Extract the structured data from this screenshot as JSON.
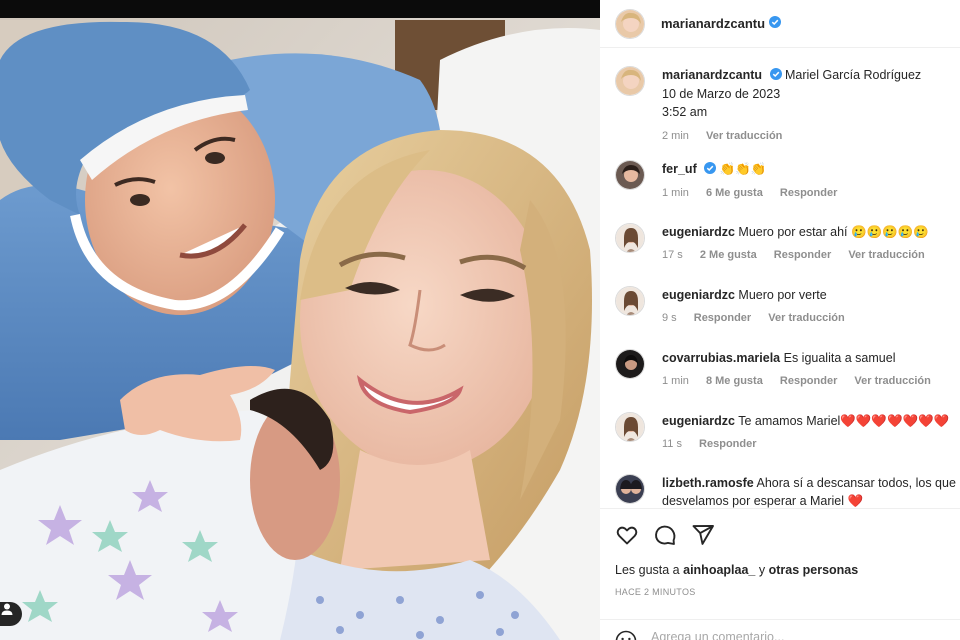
{
  "post": {
    "author": "marianardzcantu",
    "tag_icon": "user-tag-icon"
  },
  "caption": {
    "username": "marianardzcantu",
    "text": "Mariel García Rodríguez",
    "line2": "10 de Marzo de 2023",
    "line3": "3:52 am",
    "time": "2 min",
    "translate": "Ver traducción"
  },
  "comments": [
    {
      "username": "fer_uf",
      "verified": true,
      "text": "👏👏👏",
      "time": "1 min",
      "likes": "6 Me gusta",
      "reply": "Responder",
      "translate": ""
    },
    {
      "username": "eugeniardzc",
      "verified": false,
      "text": "Muero por estar ahí 🥲🥲🥲🥲🥲",
      "time": "17 s",
      "likes": "2 Me gusta",
      "reply": "Responder",
      "translate": "Ver traducción"
    },
    {
      "username": "eugeniardzc",
      "verified": false,
      "text": "Muero por verte",
      "time": "9 s",
      "likes": "",
      "reply": "Responder",
      "translate": "Ver traducción"
    },
    {
      "username": "covarrubias.mariela",
      "verified": false,
      "text": "Es igualita a samuel",
      "time": "1 min",
      "likes": "8 Me gusta",
      "reply": "Responder",
      "translate": "Ver traducción"
    },
    {
      "username": "eugeniardzc",
      "verified": false,
      "text": "Te amamos Mariel❤️❤️❤️❤️❤️❤️❤️",
      "time": "11 s",
      "likes": "",
      "reply": "Responder",
      "translate": ""
    },
    {
      "username": "lizbeth.ramosfe",
      "verified": false,
      "text": "Ahora sí a descansar todos, los que nos",
      "text2": "desvelamos por esperar a Mariel ❤️",
      "time": "",
      "likes": "",
      "reply": "",
      "translate": ""
    }
  ],
  "actions": {
    "like_icon": "heart-icon",
    "comment_icon": "comment-icon",
    "share_icon": "share-icon"
  },
  "likes": {
    "prefix": "Les gusta a",
    "user": "ainhoaplaa_",
    "middle": "y",
    "others": "otras personas"
  },
  "posted": "HACE 2 MINUTOS",
  "add_comment": {
    "placeholder": "Agrega un comentario...",
    "emoji_icon": "emoji-icon"
  },
  "colors": {
    "verified": "#3897f0",
    "meta_text": "#8e8e8e",
    "divider": "#efefef",
    "heart": "#ed4956"
  }
}
